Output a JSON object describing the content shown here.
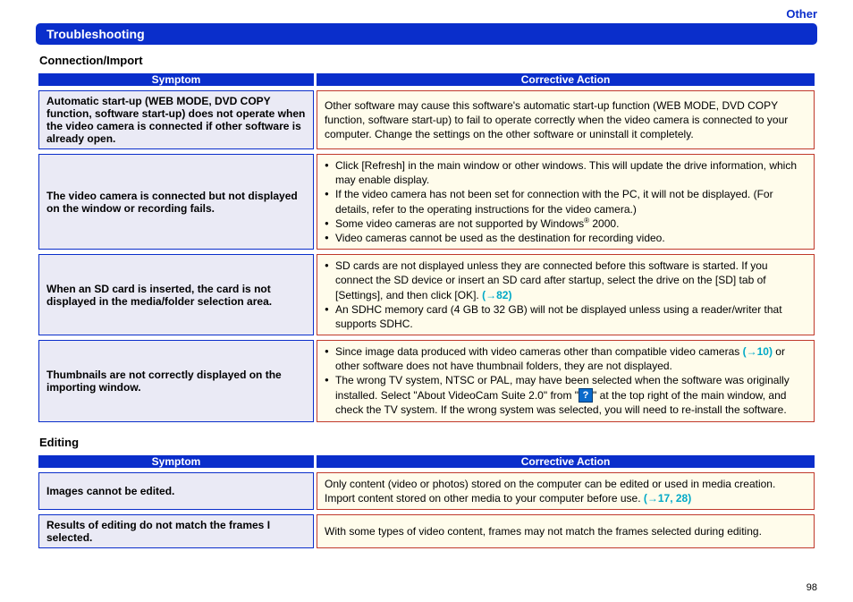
{
  "header": {
    "category_link": "Other",
    "title": "Troubleshooting"
  },
  "sections": {
    "connection": {
      "title": "Connection/Import",
      "col_symptom": "Symptom",
      "col_action": "Corrective Action",
      "rows": {
        "r1": {
          "symptom": "Automatic start-up (WEB MODE, DVD COPY function, software start-up) does not operate when the video camera is connected if other software is already open.",
          "action": "Other software may cause this software's automatic start-up function (WEB MODE, DVD COPY function, software start-up) to fail to operate correctly when the video camera is connected to your computer. Change the settings on the other software or uninstall it completely."
        },
        "r2": {
          "symptom": "The video camera is connected but not displayed on the window or recording fails.",
          "b1": "Click [Refresh] in the main window or other windows. This will update the drive information, which may enable display.",
          "b2": "If the video camera has not been set for connection with the PC, it will not be displayed. (For details, refer to the operating instructions for the video camera.)",
          "b3a": "Some video cameras are not supported by Windows",
          "b3b": " 2000.",
          "b4": "Video cameras cannot be used as the destination for recording video."
        },
        "r3": {
          "symptom": "When an SD card is inserted, the card is not displayed in the media/folder selection area.",
          "b1a": "SD cards are not displayed unless they are connected before this software is started. If you connect the SD device or insert an SD card after startup, select the drive on the [SD] tab of [Settings], and then click [OK]. ",
          "b1ref": "(→82)",
          "b2": "An SDHC memory card (4 GB to 32 GB) will not be displayed unless using a reader/writer that supports SDHC."
        },
        "r4": {
          "symptom": "Thumbnails are not correctly displayed on the importing window.",
          "b1a": "Since image data produced with video cameras other than compatible video cameras ",
          "b1ref": "(→10)",
          "b1b": " or other software does not have thumbnail folders, they are not displayed.",
          "b2a": "The wrong TV system, NTSC or PAL, may have been selected when the software was originally installed. Select \"About VideoCam Suite 2.0\" from \"",
          "b2b": "\" at the top right of the main window, and check the TV system. If the wrong system was selected, you will need to re-install the software.",
          "help_icon_label": "?"
        }
      }
    },
    "editing": {
      "title": "Editing",
      "col_symptom": "Symptom",
      "col_action": "Corrective Action",
      "rows": {
        "r1": {
          "symptom": "Images cannot be edited.",
          "action_a": "Only content (video or photos) stored on the computer can be edited or used in media creation. Import content stored on other media to your computer before use. ",
          "action_ref": "(→17, 28)"
        },
        "r2": {
          "symptom": "Results of editing do not match the frames I selected.",
          "action": "With some types of video content, frames may not match the frames selected during editing."
        }
      }
    }
  },
  "page_number": "98"
}
